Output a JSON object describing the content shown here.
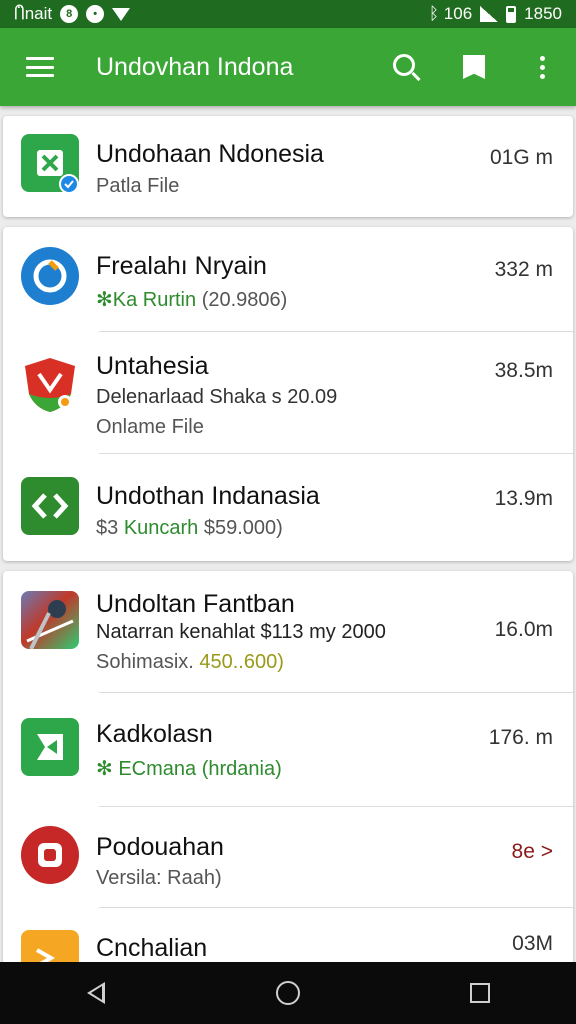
{
  "status_bar": {
    "left_text": "Ⴖ̈nait",
    "right_text": "ᛒ 106",
    "time": "1850"
  },
  "app_bar": {
    "title": "Undovhan Indona"
  },
  "list": [
    {
      "title": "Undohaan Ndonesia",
      "subtitle": "Patla File",
      "size": "01G m"
    },
    {
      "title": "Frealahı Nryain",
      "subtitle": "✻Ka Rurtin",
      "subtitle_extra": "(20.9806)",
      "size": "332 m"
    },
    {
      "title": "Untahesia",
      "subtitle": "Delenarlaad Shaka s 20.09",
      "subtitle2": "Onlame File",
      "size": "38.5m"
    },
    {
      "title": "Undothan Indanasia",
      "subtitle_prefix": "$3",
      "subtitle": "Kuncarh",
      "subtitle_extra": "$59.000)",
      "size": "13.9m"
    },
    {
      "title": "Undoltan Fantban",
      "subtitle": "Natarran kenahlat $113 my 2000",
      "subtitle2_prefix": "Sohimasix.",
      "subtitle2": "450..600)",
      "size": "16.0m"
    },
    {
      "title": "Kadkolasn",
      "subtitle": "✻ ECmana",
      "subtitle_extra": "(hrdania)",
      "size": "176. m"
    },
    {
      "title": "Podouahan",
      "subtitle": "Versila: Raah)",
      "size": "8e >"
    },
    {
      "title": "Cnchalian",
      "size": "03M"
    }
  ],
  "icons": {
    "row1": "green-app-icon",
    "row2": "blue-circle-app-icon",
    "row3": "red-shield-app-icon",
    "row4": "green-arrows-app-icon",
    "row5": "game-app-icon",
    "row6": "green-flag-app-icon",
    "row7": "red-circle-app-icon",
    "row8": "orange-app-icon"
  },
  "colors": {
    "status_bar": "#1f6b1f",
    "app_bar": "#3aa635",
    "accent_green": "#2e8b2e"
  }
}
